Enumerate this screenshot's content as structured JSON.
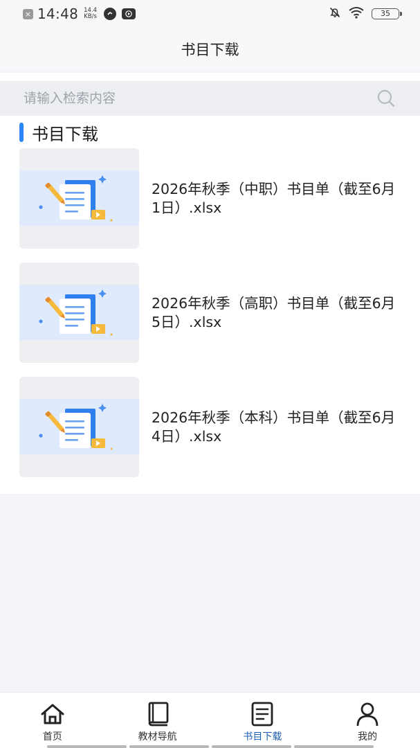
{
  "status_bar": {
    "time": "14:48",
    "speed_value": "14.4",
    "speed_unit": "KB/s",
    "battery": "35"
  },
  "header": {
    "title": "书目下载"
  },
  "search": {
    "placeholder": "请输入检索内容"
  },
  "section": {
    "title": "书目下载"
  },
  "files": [
    {
      "name": "2026年秋季（中职）书目单（截至6月1日）.xlsx"
    },
    {
      "name": "2026年秋季（高职）书目单（截至6月5日）.xlsx"
    },
    {
      "name": "2026年秋季（本科）书目单（截至6月4日）.xlsx"
    }
  ],
  "tabs": [
    {
      "label": "首页",
      "icon": "home-icon"
    },
    {
      "label": "教材导航",
      "icon": "book-icon"
    },
    {
      "label": "书目下载",
      "icon": "document-list-icon",
      "active": true
    },
    {
      "label": "我的",
      "icon": "user-icon"
    }
  ],
  "colors": {
    "accent": "#2d86f5",
    "active_tab": "#1e5fb8"
  }
}
